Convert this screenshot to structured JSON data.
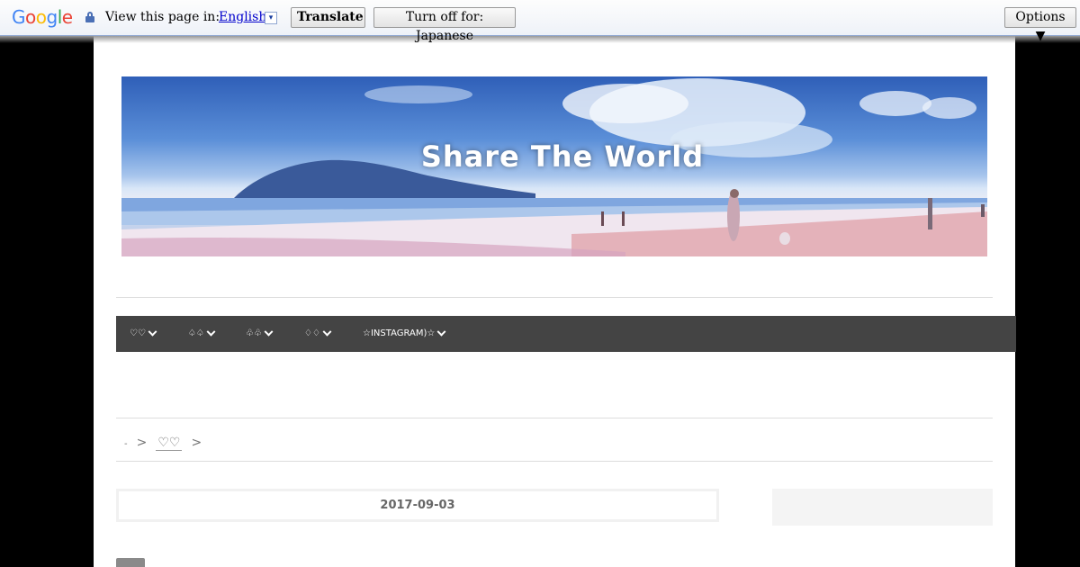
{
  "translate_bar": {
    "logo": "Google",
    "label": "View this page in:",
    "language": "English",
    "language_arrow": "▾",
    "translate_button": "Translate",
    "turn_off_button": "Turn off for: Japanese",
    "options_button": "Options ▼",
    "icons": {
      "lock": "lock-icon"
    }
  },
  "header": {
    "site_title": "Share The World"
  },
  "nav": {
    "items": [
      {
        "label": "♡♡"
      },
      {
        "label": "♤♤"
      },
      {
        "label": "♧♧"
      },
      {
        "label": "♢♢"
      },
      {
        "label": "☆INSTAGRAM)☆"
      }
    ]
  },
  "breadcrumb": {
    "home": "-",
    "separator": ">",
    "current": "♡♡"
  },
  "post": {
    "date": "2017-09-03"
  },
  "colors": {
    "nav_background": "#444444",
    "page_background": "#ffffff",
    "body_background": "#000000"
  }
}
